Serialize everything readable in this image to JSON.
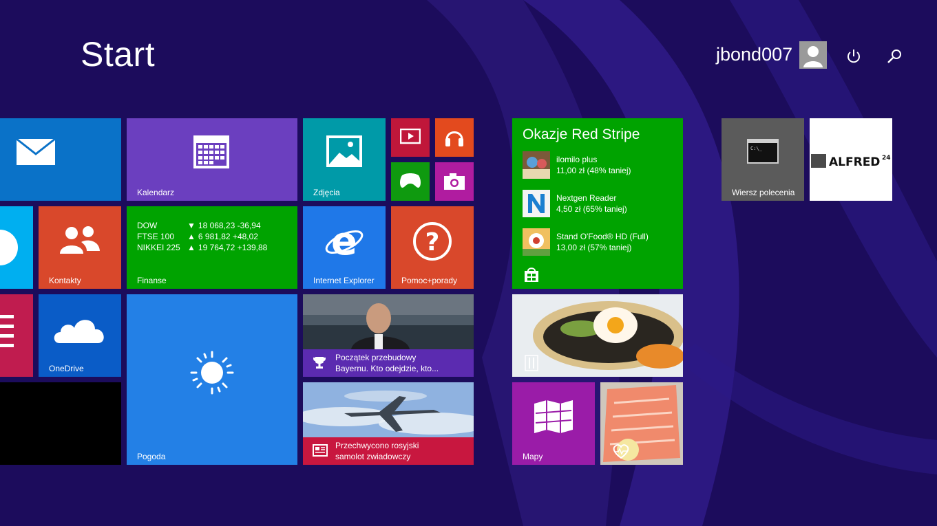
{
  "header": {
    "title": "Start",
    "user_name": "jbond007"
  },
  "tiles": {
    "mail": {
      "label": ""
    },
    "calendar": {
      "label": "Kalendarz"
    },
    "photos": {
      "label": "Zdjęcia"
    },
    "contacts": {
      "label": "Kontakty"
    },
    "finance": {
      "label": "Finanse",
      "rows": [
        {
          "name": "DOW",
          "arrow": "▼",
          "value": "18 068,23 -36,94"
        },
        {
          "name": "FTSE 100",
          "arrow": "▲",
          "value": "6 981,82 +48,02"
        },
        {
          "name": "NIKKEI 225",
          "arrow": "▲",
          "value": "19 764,72 +139,88"
        }
      ]
    },
    "ie": {
      "label": "Internet Explorer"
    },
    "help": {
      "label": "Pomoc+porady"
    },
    "onedrive": {
      "label": "OneDrive"
    },
    "weather": {
      "label": "Pogoda"
    },
    "sport_news": {
      "line1": "Początek przebudowy",
      "line2": "Bayernu. Kto odejdzie, kto..."
    },
    "news": {
      "line1": "Przechwycono rosyjski",
      "line2": "samolot zwiadowczy"
    },
    "store": {
      "title": "Okazje Red Stripe",
      "items": [
        {
          "name": "ilomilo plus",
          "price": "11,00 zł (48% taniej)"
        },
        {
          "name": "Nextgen Reader",
          "price": "4,50 zł (65% taniej)"
        },
        {
          "name": "Stand O'Food® HD (Full)",
          "price": "13,00 zł (57% taniej)"
        }
      ]
    },
    "maps": {
      "label": "Mapy"
    },
    "cmd": {
      "label": "Wiersz polecenia"
    },
    "alfred": {
      "logo_text": "ALFRED²⁴"
    }
  },
  "colors": {
    "background": "#1c0c5c",
    "mail": "#0a72c8",
    "calendar": "#6b3fbf",
    "photos": "#009aa8",
    "finance": "#00a300",
    "ie": "#1f78e8",
    "help": "#d9482b",
    "contacts": "#d9482b",
    "onedrive": "#0a5cc7",
    "weather": "#2380e6",
    "store": "#00a300",
    "maps": "#9a1ca8",
    "cmd": "#5b5b5b"
  }
}
